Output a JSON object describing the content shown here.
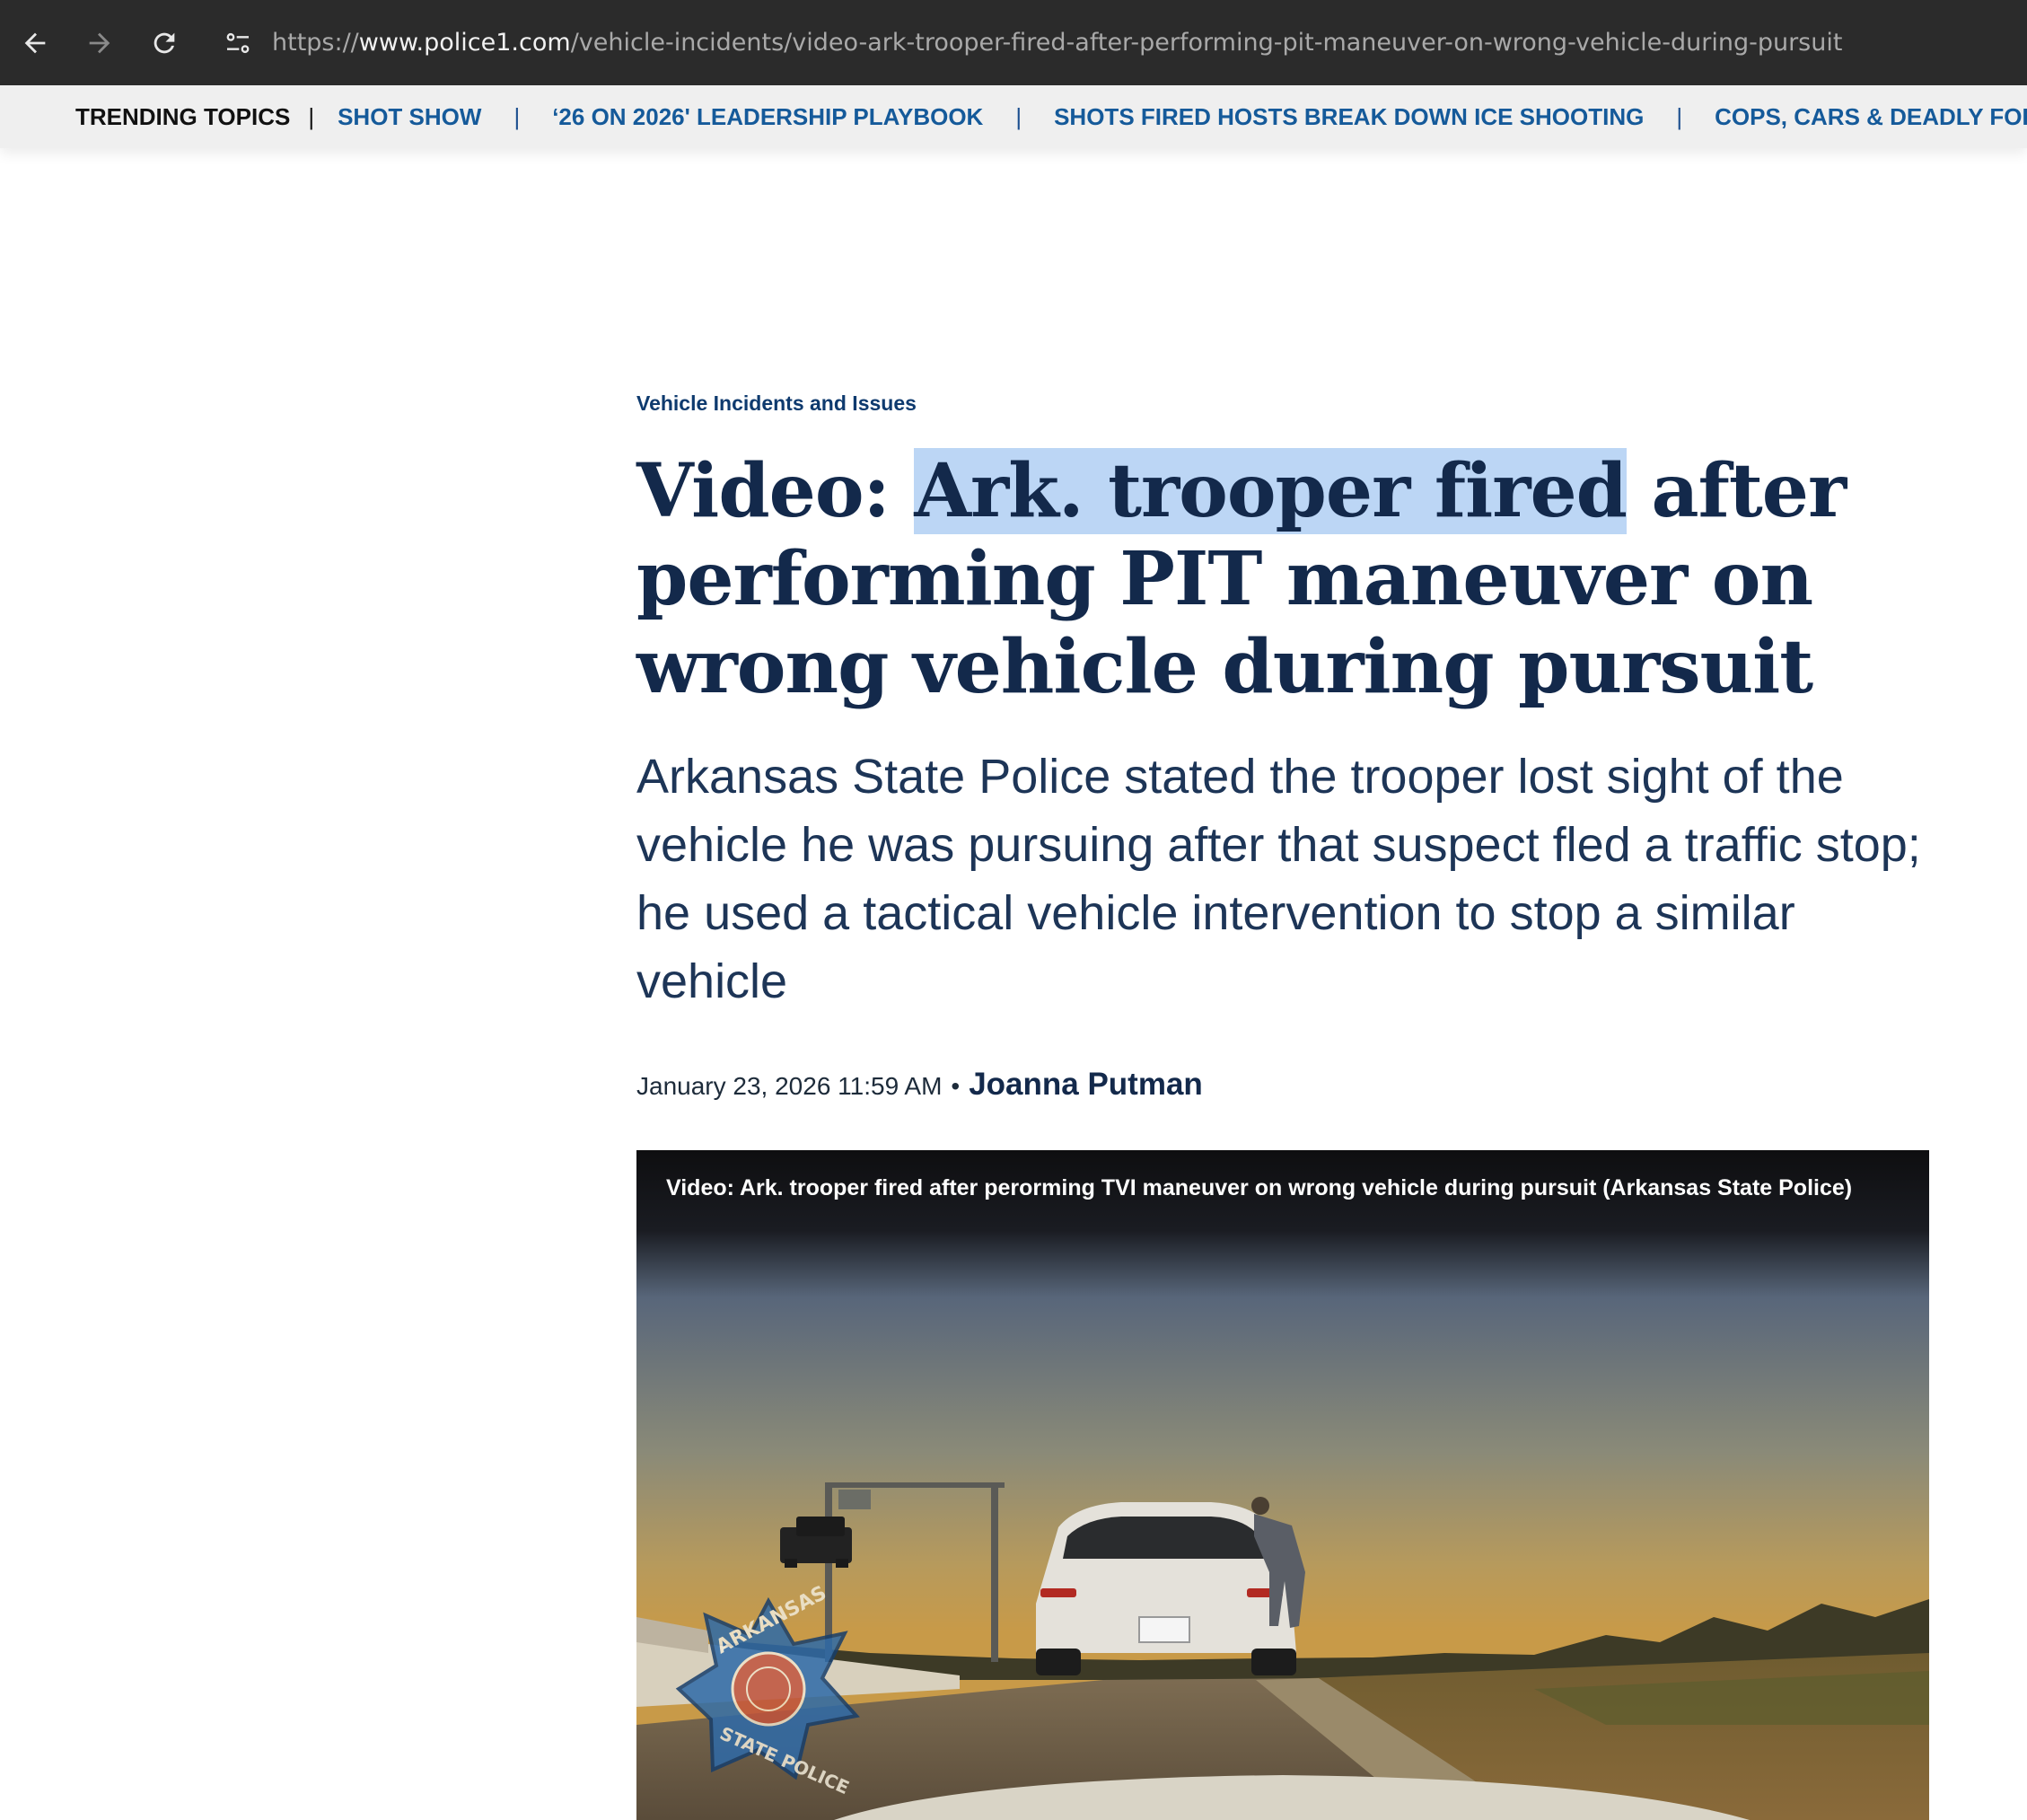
{
  "browser": {
    "url_scheme": "https://",
    "url_host": "www.police1.com",
    "url_path": "/vehicle-incidents/video-ark-trooper-fired-after-performing-pit-maneuver-on-wrong-vehicle-during-pursuit"
  },
  "trending": {
    "label": "TRENDING TOPICS",
    "separator": "|",
    "links": [
      "SHOT SHOW",
      "‘26 ON 2026' LEADERSHIP PLAYBOOK",
      "SHOTS FIRED HOSTS BREAK DOWN ICE SHOOTING",
      "COPS, CARS & DEADLY FORCE"
    ]
  },
  "article": {
    "category": "Vehicle Incidents and Issues",
    "headline_before": "Video: ",
    "headline_highlight": "Ark. trooper fired",
    "headline_after": " after performing PIT maneuver on wrong vehicle during pursuit",
    "dek": "Arkansas State Police stated the trooper lost sight of the vehicle he was pursuing after that suspect fled a traffic stop; he used a tactical vehicle intervention to stop a similar vehicle",
    "date": "January 23, 2026 11:59 AM",
    "dot": "•",
    "author": "Joanna Putman"
  },
  "video": {
    "title": "Video: Ark. trooper fired after perorming TVI maneuver on wrong vehicle during pursuit (Arkansas State Police)",
    "seal_text_top": "ARKANSAS",
    "seal_text_bottom": "STATE POLICE"
  },
  "colors": {
    "browser_bar": "#2b2b2b",
    "trending_bg": "#efefef",
    "link_blue": "#155a9a",
    "headline_navy": "#13294b",
    "highlight": "#bcd6f5"
  }
}
